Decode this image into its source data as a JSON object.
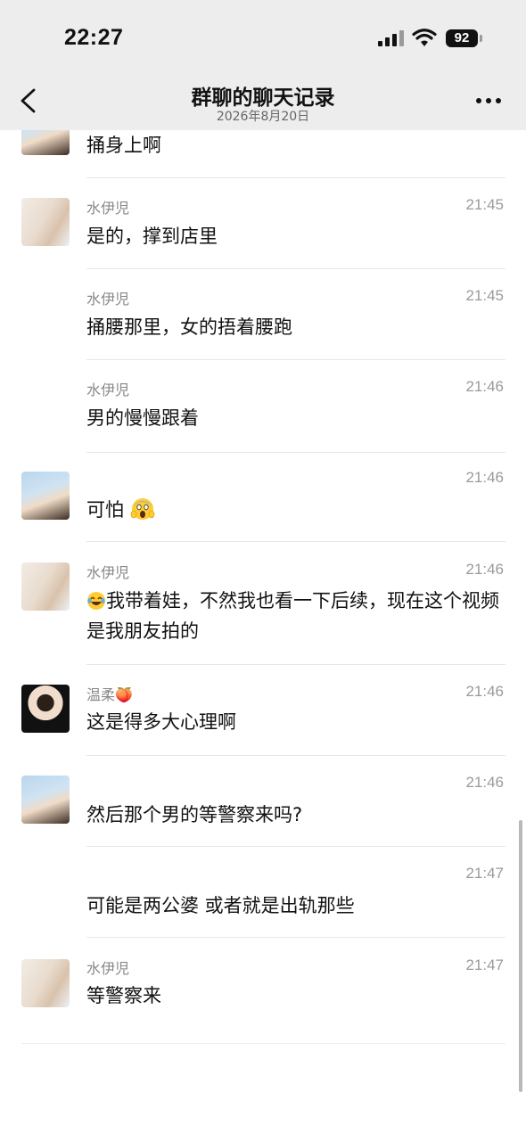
{
  "status_bar": {
    "time": "22:27",
    "battery": "92",
    "icons": [
      "signal-icon",
      "wifi-icon",
      "battery-icon"
    ]
  },
  "header": {
    "title": "群聊的聊天记录",
    "subtitle": "2026年8月20日",
    "back_icon": "chevron-left-icon",
    "more_icon": "more-dots-icon"
  },
  "messages": [
    {
      "sender": "",
      "time": "",
      "text": "捅身上啊",
      "avatar": "avatar-portrait-warm"
    },
    {
      "sender": "水伊児",
      "time": "21:45",
      "text": "是的，撑到店里",
      "avatar": "avatar-portrait-light"
    },
    {
      "sender": "水伊児",
      "time": "21:45",
      "text": "捅腰那里，女的捂着腰跑",
      "avatar": ""
    },
    {
      "sender": "水伊児",
      "time": "21:46",
      "text": "男的慢慢跟着",
      "avatar": ""
    },
    {
      "sender": "",
      "time": "21:46",
      "text": "可怕",
      "emoji": "scream-emoji",
      "avatar": "avatar-portrait-warm"
    },
    {
      "sender": "水伊児",
      "time": "21:46",
      "emoji": "laughing-emoji",
      "text": "我带着娃，不然我也看一下后续，现在这个视频是我朋友拍的",
      "avatar": "avatar-portrait-light"
    },
    {
      "sender": "温柔",
      "sender_emoji": "🍑",
      "time": "21:46",
      "text": "这是得多大心理啊",
      "avatar": "avatar-portrait-dark"
    },
    {
      "sender": "",
      "time": "21:46",
      "text": "然后那个男的等警察来吗?",
      "avatar": "avatar-portrait-warm"
    },
    {
      "sender": "",
      "time": "21:47",
      "text": "可能是两公婆 或者就是出轨那些",
      "avatar": ""
    },
    {
      "sender": "水伊児",
      "time": "21:47",
      "text": "等警察来",
      "avatar": "avatar-portrait-light"
    }
  ],
  "colors": {
    "header_bg": "#ededed",
    "page_bg": "#ffffff",
    "meta_text": "#888888",
    "divider": "#e6e6e6"
  }
}
